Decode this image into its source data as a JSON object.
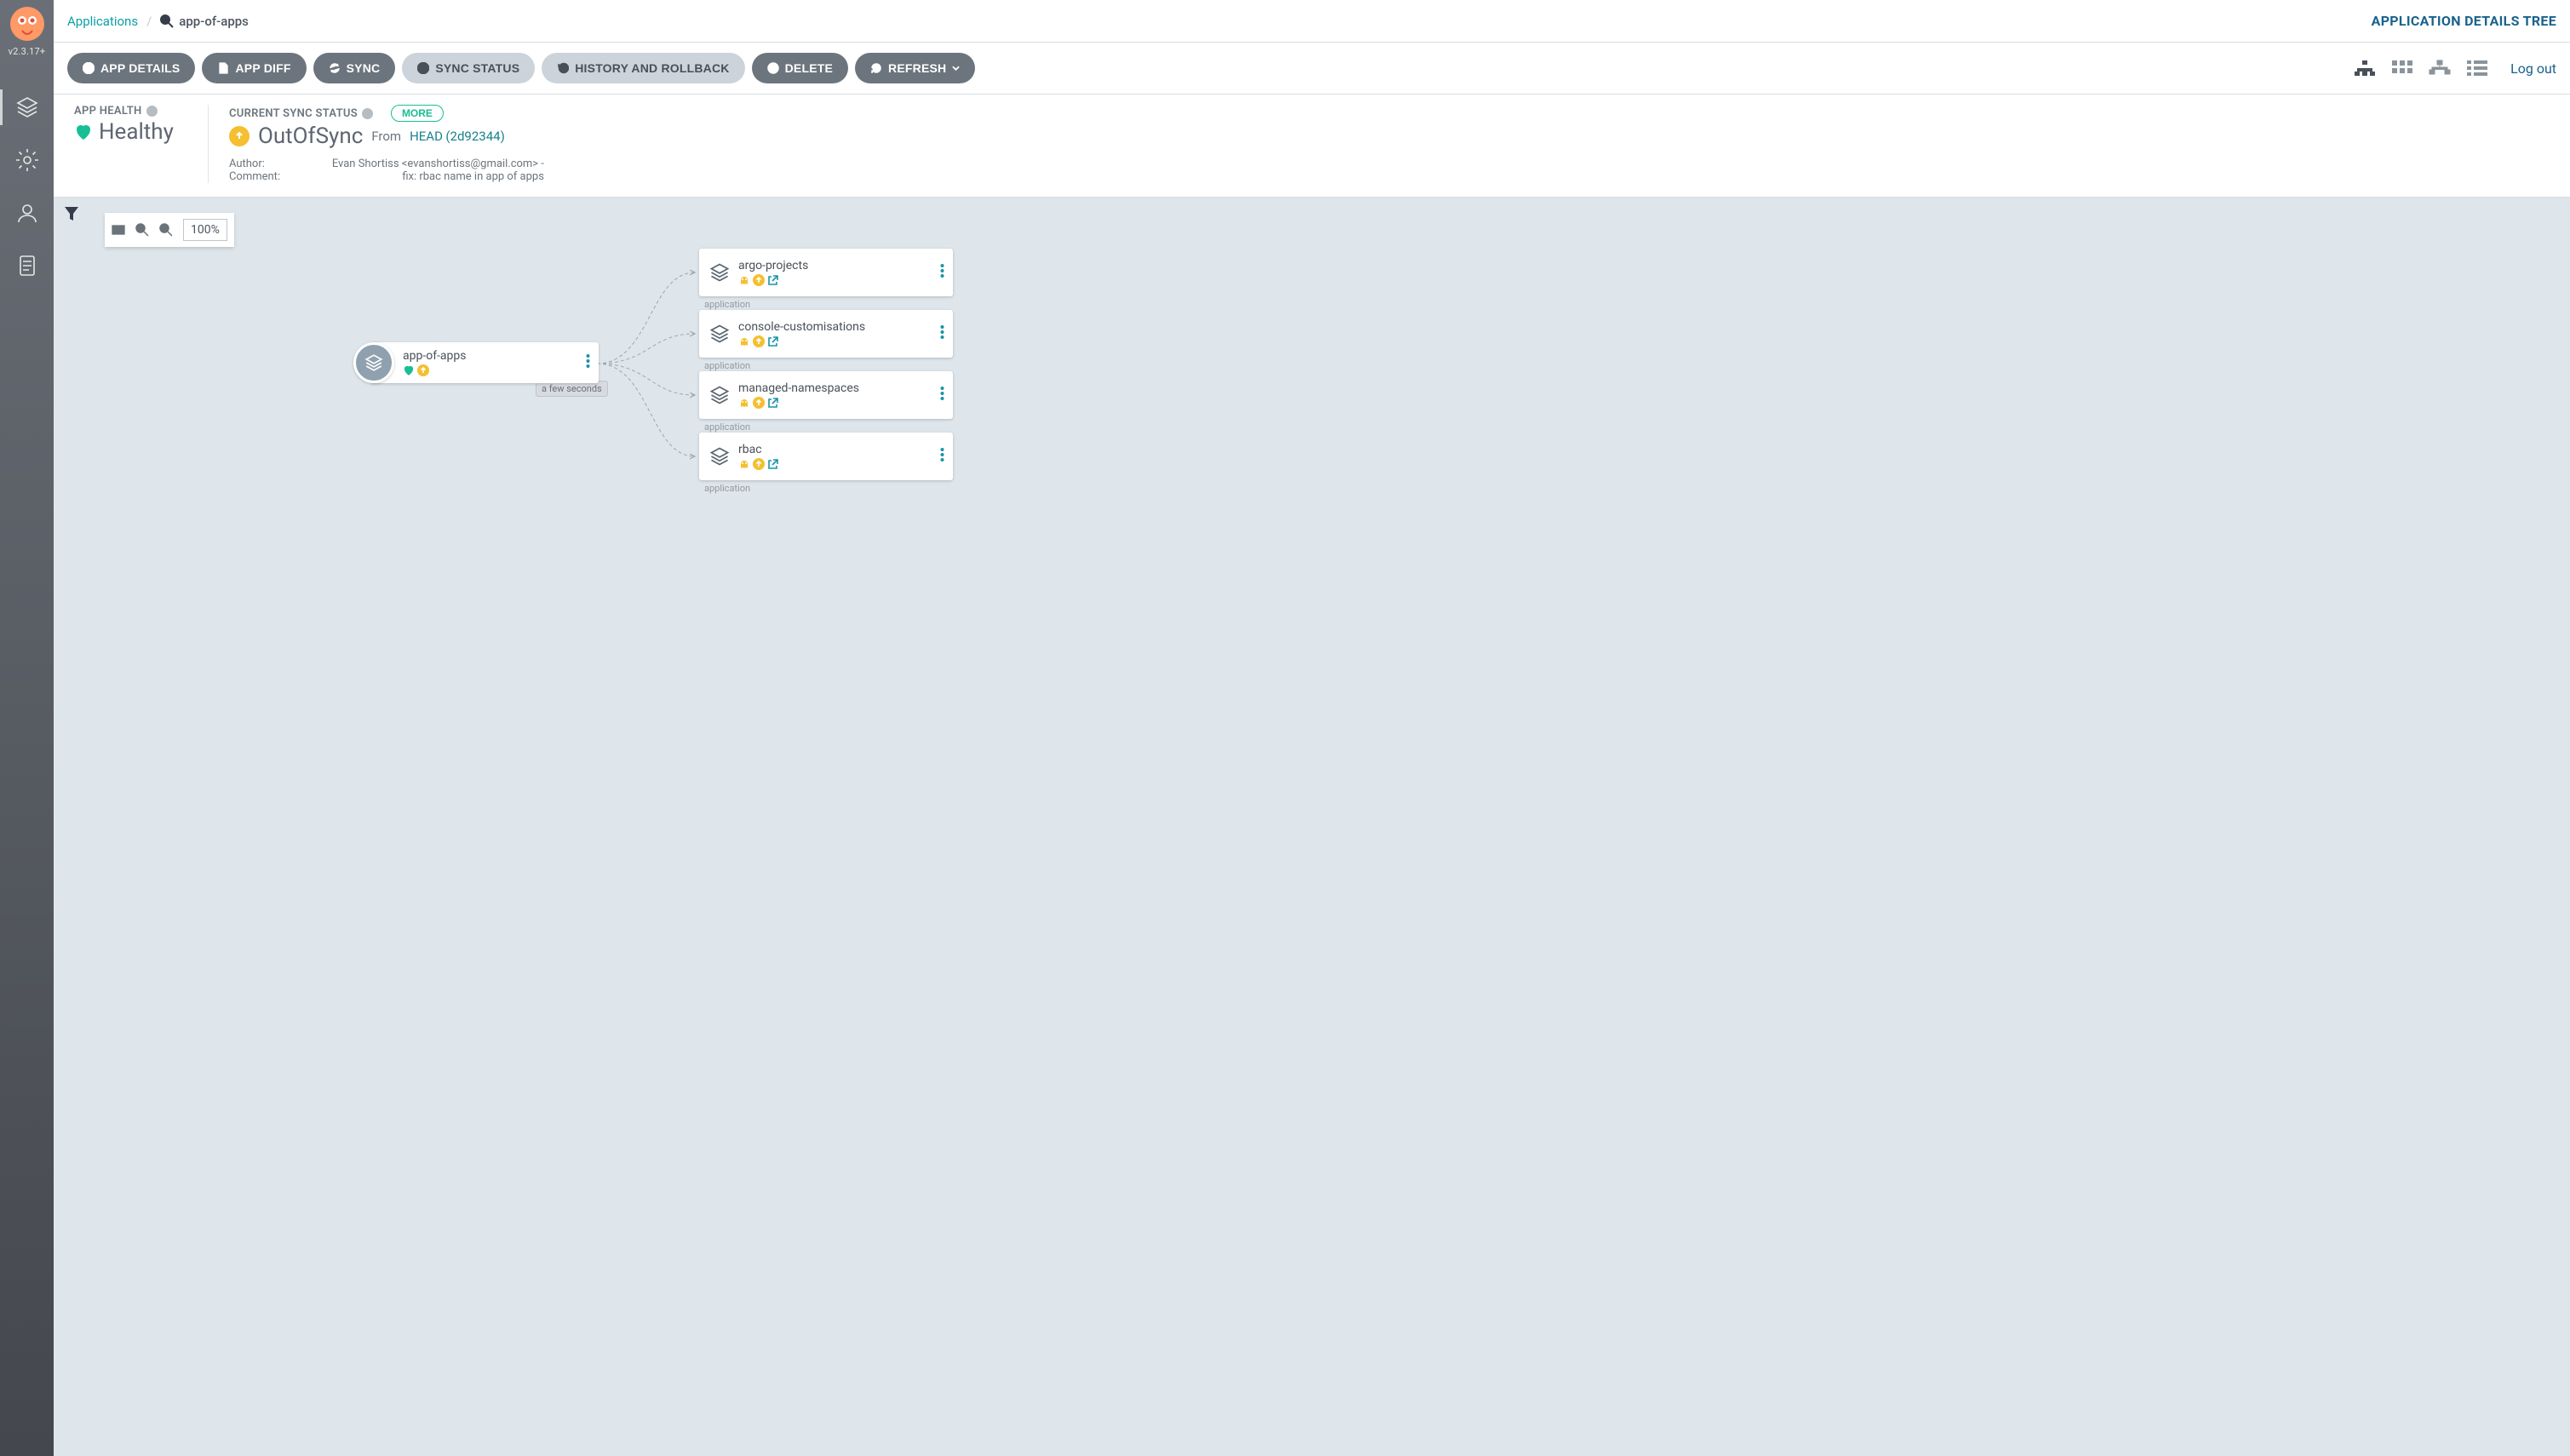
{
  "version": "v2.3.17+",
  "breadcrumb": {
    "root": "Applications",
    "app": "app-of-apps"
  },
  "title_right": "APPLICATION DETAILS TREE",
  "buttons": {
    "details": "APP DETAILS",
    "diff": "APP DIFF",
    "sync": "SYNC",
    "sync_status": "SYNC STATUS",
    "history": "HISTORY AND ROLLBACK",
    "delete": "DELETE",
    "refresh": "REFRESH"
  },
  "logout": "Log out",
  "status": {
    "health_label": "APP HEALTH",
    "health_value": "Healthy",
    "sync_label": "CURRENT SYNC STATUS",
    "sync_value": "OutOfSync",
    "from": "From",
    "head": "HEAD",
    "rev": "(2d92344)",
    "more": "MORE",
    "author_label": "Author:",
    "author_value": "Evan Shortiss <evanshortiss@gmail.com> -",
    "comment_label": "Comment:",
    "comment_value": "fix: rbac name in app of apps"
  },
  "zoom": "100%",
  "root_node": {
    "name": "app-of-apps"
  },
  "child_kind": "application",
  "children": [
    {
      "name": "argo-projects"
    },
    {
      "name": "console-customisations"
    },
    {
      "name": "managed-namespaces"
    },
    {
      "name": "rbac"
    }
  ],
  "time_badge": "a few seconds"
}
